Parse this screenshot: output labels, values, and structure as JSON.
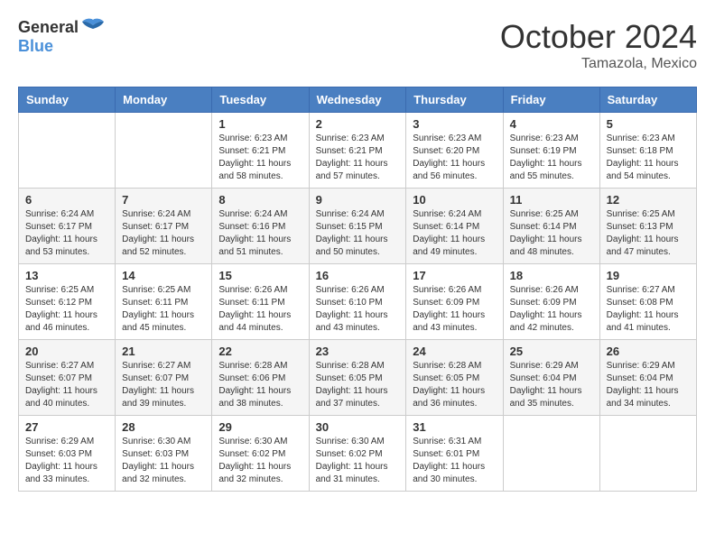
{
  "header": {
    "logo_text_general": "General",
    "logo_text_blue": "Blue",
    "month": "October 2024",
    "location": "Tamazola, Mexico"
  },
  "weekdays": [
    "Sunday",
    "Monday",
    "Tuesday",
    "Wednesday",
    "Thursday",
    "Friday",
    "Saturday"
  ],
  "weeks": [
    [
      {
        "day": "",
        "sunrise": "",
        "sunset": "",
        "daylight": ""
      },
      {
        "day": "",
        "sunrise": "",
        "sunset": "",
        "daylight": ""
      },
      {
        "day": "1",
        "sunrise": "Sunrise: 6:23 AM",
        "sunset": "Sunset: 6:21 PM",
        "daylight": "Daylight: 11 hours and 58 minutes."
      },
      {
        "day": "2",
        "sunrise": "Sunrise: 6:23 AM",
        "sunset": "Sunset: 6:21 PM",
        "daylight": "Daylight: 11 hours and 57 minutes."
      },
      {
        "day": "3",
        "sunrise": "Sunrise: 6:23 AM",
        "sunset": "Sunset: 6:20 PM",
        "daylight": "Daylight: 11 hours and 56 minutes."
      },
      {
        "day": "4",
        "sunrise": "Sunrise: 6:23 AM",
        "sunset": "Sunset: 6:19 PM",
        "daylight": "Daylight: 11 hours and 55 minutes."
      },
      {
        "day": "5",
        "sunrise": "Sunrise: 6:23 AM",
        "sunset": "Sunset: 6:18 PM",
        "daylight": "Daylight: 11 hours and 54 minutes."
      }
    ],
    [
      {
        "day": "6",
        "sunrise": "Sunrise: 6:24 AM",
        "sunset": "Sunset: 6:17 PM",
        "daylight": "Daylight: 11 hours and 53 minutes."
      },
      {
        "day": "7",
        "sunrise": "Sunrise: 6:24 AM",
        "sunset": "Sunset: 6:17 PM",
        "daylight": "Daylight: 11 hours and 52 minutes."
      },
      {
        "day": "8",
        "sunrise": "Sunrise: 6:24 AM",
        "sunset": "Sunset: 6:16 PM",
        "daylight": "Daylight: 11 hours and 51 minutes."
      },
      {
        "day": "9",
        "sunrise": "Sunrise: 6:24 AM",
        "sunset": "Sunset: 6:15 PM",
        "daylight": "Daylight: 11 hours and 50 minutes."
      },
      {
        "day": "10",
        "sunrise": "Sunrise: 6:24 AM",
        "sunset": "Sunset: 6:14 PM",
        "daylight": "Daylight: 11 hours and 49 minutes."
      },
      {
        "day": "11",
        "sunrise": "Sunrise: 6:25 AM",
        "sunset": "Sunset: 6:14 PM",
        "daylight": "Daylight: 11 hours and 48 minutes."
      },
      {
        "day": "12",
        "sunrise": "Sunrise: 6:25 AM",
        "sunset": "Sunset: 6:13 PM",
        "daylight": "Daylight: 11 hours and 47 minutes."
      }
    ],
    [
      {
        "day": "13",
        "sunrise": "Sunrise: 6:25 AM",
        "sunset": "Sunset: 6:12 PM",
        "daylight": "Daylight: 11 hours and 46 minutes."
      },
      {
        "day": "14",
        "sunrise": "Sunrise: 6:25 AM",
        "sunset": "Sunset: 6:11 PM",
        "daylight": "Daylight: 11 hours and 45 minutes."
      },
      {
        "day": "15",
        "sunrise": "Sunrise: 6:26 AM",
        "sunset": "Sunset: 6:11 PM",
        "daylight": "Daylight: 11 hours and 44 minutes."
      },
      {
        "day": "16",
        "sunrise": "Sunrise: 6:26 AM",
        "sunset": "Sunset: 6:10 PM",
        "daylight": "Daylight: 11 hours and 43 minutes."
      },
      {
        "day": "17",
        "sunrise": "Sunrise: 6:26 AM",
        "sunset": "Sunset: 6:09 PM",
        "daylight": "Daylight: 11 hours and 43 minutes."
      },
      {
        "day": "18",
        "sunrise": "Sunrise: 6:26 AM",
        "sunset": "Sunset: 6:09 PM",
        "daylight": "Daylight: 11 hours and 42 minutes."
      },
      {
        "day": "19",
        "sunrise": "Sunrise: 6:27 AM",
        "sunset": "Sunset: 6:08 PM",
        "daylight": "Daylight: 11 hours and 41 minutes."
      }
    ],
    [
      {
        "day": "20",
        "sunrise": "Sunrise: 6:27 AM",
        "sunset": "Sunset: 6:07 PM",
        "daylight": "Daylight: 11 hours and 40 minutes."
      },
      {
        "day": "21",
        "sunrise": "Sunrise: 6:27 AM",
        "sunset": "Sunset: 6:07 PM",
        "daylight": "Daylight: 11 hours and 39 minutes."
      },
      {
        "day": "22",
        "sunrise": "Sunrise: 6:28 AM",
        "sunset": "Sunset: 6:06 PM",
        "daylight": "Daylight: 11 hours and 38 minutes."
      },
      {
        "day": "23",
        "sunrise": "Sunrise: 6:28 AM",
        "sunset": "Sunset: 6:05 PM",
        "daylight": "Daylight: 11 hours and 37 minutes."
      },
      {
        "day": "24",
        "sunrise": "Sunrise: 6:28 AM",
        "sunset": "Sunset: 6:05 PM",
        "daylight": "Daylight: 11 hours and 36 minutes."
      },
      {
        "day": "25",
        "sunrise": "Sunrise: 6:29 AM",
        "sunset": "Sunset: 6:04 PM",
        "daylight": "Daylight: 11 hours and 35 minutes."
      },
      {
        "day": "26",
        "sunrise": "Sunrise: 6:29 AM",
        "sunset": "Sunset: 6:04 PM",
        "daylight": "Daylight: 11 hours and 34 minutes."
      }
    ],
    [
      {
        "day": "27",
        "sunrise": "Sunrise: 6:29 AM",
        "sunset": "Sunset: 6:03 PM",
        "daylight": "Daylight: 11 hours and 33 minutes."
      },
      {
        "day": "28",
        "sunrise": "Sunrise: 6:30 AM",
        "sunset": "Sunset: 6:03 PM",
        "daylight": "Daylight: 11 hours and 32 minutes."
      },
      {
        "day": "29",
        "sunrise": "Sunrise: 6:30 AM",
        "sunset": "Sunset: 6:02 PM",
        "daylight": "Daylight: 11 hours and 32 minutes."
      },
      {
        "day": "30",
        "sunrise": "Sunrise: 6:30 AM",
        "sunset": "Sunset: 6:02 PM",
        "daylight": "Daylight: 11 hours and 31 minutes."
      },
      {
        "day": "31",
        "sunrise": "Sunrise: 6:31 AM",
        "sunset": "Sunset: 6:01 PM",
        "daylight": "Daylight: 11 hours and 30 minutes."
      },
      {
        "day": "",
        "sunrise": "",
        "sunset": "",
        "daylight": ""
      },
      {
        "day": "",
        "sunrise": "",
        "sunset": "",
        "daylight": ""
      }
    ]
  ]
}
